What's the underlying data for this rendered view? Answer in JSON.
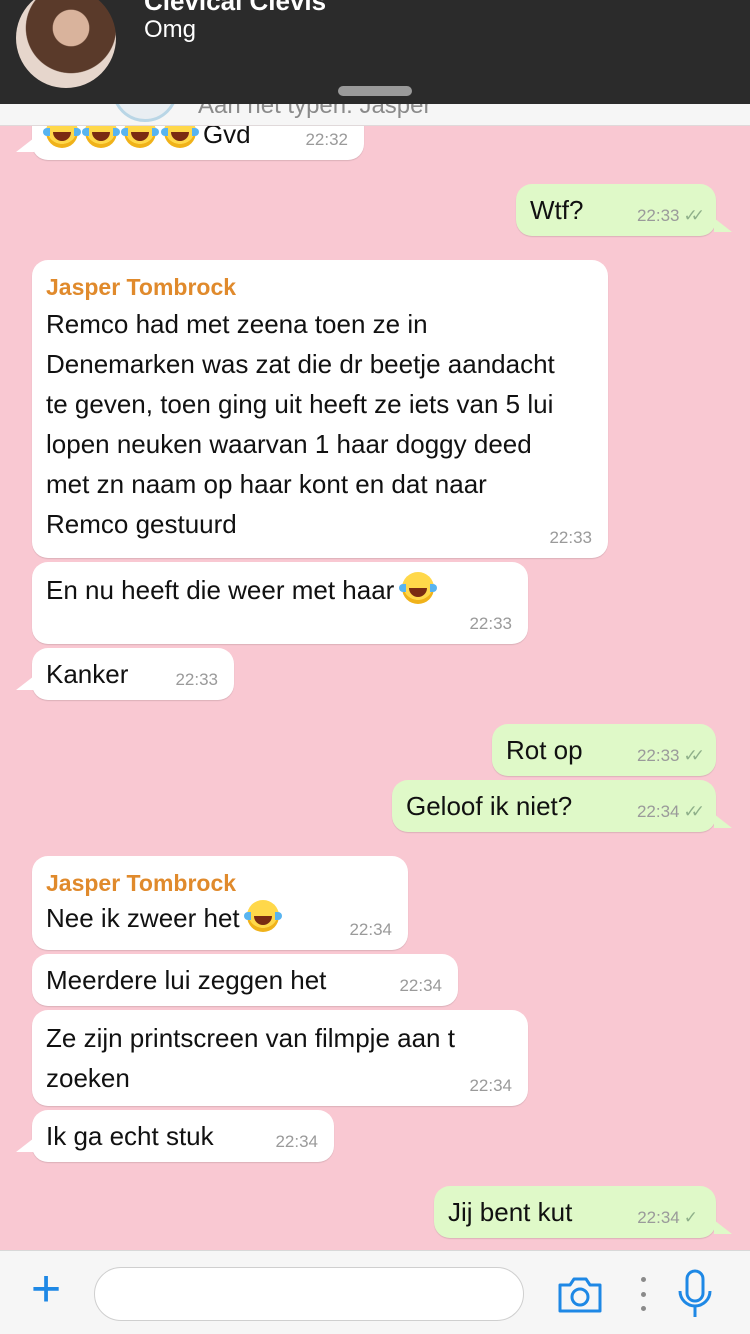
{
  "notification": {
    "sender": "Clevical Clevis",
    "preview": "Omg"
  },
  "header": {
    "typing_status": "Aan het typen: Jasper"
  },
  "messages": [
    {
      "dir": "in",
      "author": "",
      "text": "😂😂😂😂 Gvd",
      "time": "22:32",
      "ticks": ""
    },
    {
      "dir": "out",
      "author": "",
      "text": "Wtf?",
      "time": "22:33",
      "ticks": "✓✓"
    },
    {
      "dir": "in",
      "author": "Jasper Tombrock",
      "text": "Remco had met zeena toen ze in Denemarken was zat die dr beetje aandacht te geven, toen ging uit heeft ze iets van 5 lui lopen neuken waarvan 1 haar doggy deed met zn naam op haar kont en dat naar Remco gestuurd",
      "time": "22:33",
      "ticks": ""
    },
    {
      "dir": "in",
      "author": "",
      "text": "En nu heeft die weer met haar 😂",
      "time": "22:33",
      "ticks": ""
    },
    {
      "dir": "in",
      "author": "",
      "text": "Kanker",
      "time": "22:33",
      "ticks": ""
    },
    {
      "dir": "out",
      "author": "",
      "text": "Rot op",
      "time": "22:33",
      "ticks": "✓✓"
    },
    {
      "dir": "out",
      "author": "",
      "text": "Geloof ik niet?",
      "time": "22:34",
      "ticks": "✓✓"
    },
    {
      "dir": "in",
      "author": "Jasper Tombrock",
      "text": "Nee ik zweer het 😂",
      "time": "22:34",
      "ticks": ""
    },
    {
      "dir": "in",
      "author": "",
      "text": "Meerdere lui zeggen het",
      "time": "22:34",
      "ticks": ""
    },
    {
      "dir": "in",
      "author": "",
      "text": "Ze zijn printscreen van filmpje aan t zoeken",
      "time": "22:34",
      "ticks": ""
    },
    {
      "dir": "in",
      "author": "",
      "text": "Ik ga echt stuk",
      "time": "22:34",
      "ticks": ""
    },
    {
      "dir": "out",
      "author": "",
      "text": "Jij bent kut",
      "time": "22:34",
      "ticks": "✓"
    }
  ],
  "input": {
    "placeholder": "",
    "value": ""
  },
  "colors": {
    "chat_background": "#f9c8d2",
    "incoming_bubble": "#ffffff",
    "outgoing_bubble": "#dff9c8",
    "author_name": "#e08a2c",
    "accent": "#1e88e5"
  },
  "icons": [
    "plus-icon",
    "camera-icon",
    "more-dots-icon",
    "microphone-icon",
    "read-ticks-icon",
    "sent-tick-icon",
    "laughing-emoji-icon"
  ]
}
